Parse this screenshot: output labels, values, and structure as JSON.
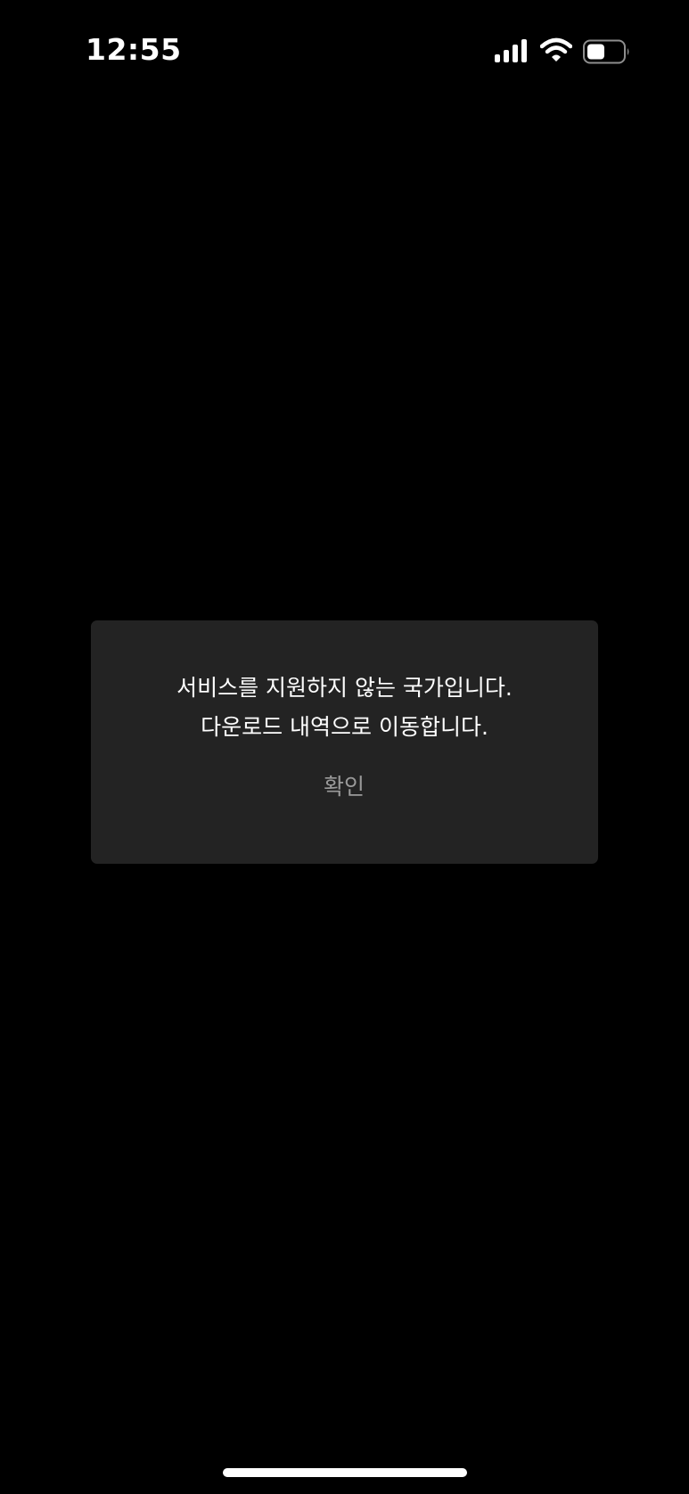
{
  "status_bar": {
    "time": "12:55",
    "icons": [
      "signal-icon",
      "wifi-icon",
      "battery-icon"
    ]
  },
  "dialog": {
    "message_lines": [
      "서비스를 지원하지 않는 국가입니다.",
      "다운로드 내역으로 이동합니다."
    ],
    "confirm_label": "확인"
  },
  "colors": {
    "background": "#000000",
    "dialog_background": "#232323",
    "message_text": "#ffffff",
    "button_text": "#9a9a9a"
  }
}
